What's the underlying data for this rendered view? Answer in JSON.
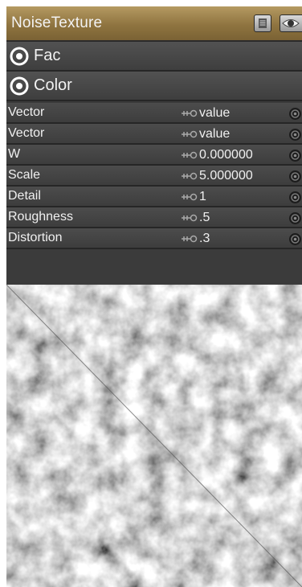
{
  "node": {
    "title": "NoiseTexture",
    "header_color": "#8f7440",
    "icons": {
      "list": "list-view-icon",
      "eye": "eye-preview-icon"
    }
  },
  "outputs": [
    {
      "label": "Fac",
      "icon": "output-socket-icon"
    },
    {
      "label": "Color",
      "icon": "output-socket-icon"
    }
  ],
  "inputs": [
    {
      "label": "Vector",
      "value": "value"
    },
    {
      "label": "Vector",
      "value": "value"
    },
    {
      "label": "W",
      "value": "0.000000"
    },
    {
      "label": "Scale",
      "value": "5.000000"
    },
    {
      "label": "Detail",
      "value": "1"
    },
    {
      "label": "Roughness",
      "value": ".5"
    },
    {
      "label": "Distortion",
      "value": ".3"
    }
  ],
  "input_icons": {
    "plug": "plug-connector-icon",
    "socket": "input-socket-icon"
  },
  "preview": {
    "type": "noise-texture-preview"
  }
}
